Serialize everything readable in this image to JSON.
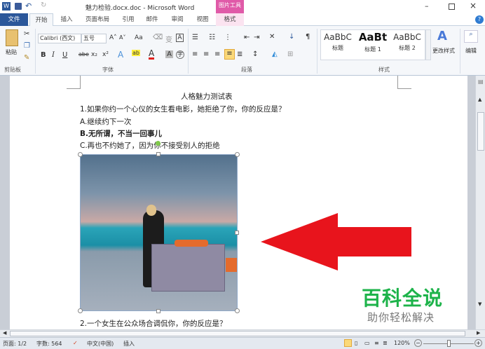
{
  "window": {
    "title": "魅力检验.docx.doc - Microsoft Word",
    "contextual_tab": "图片工具"
  },
  "quick_access": {
    "undo": "↶",
    "redo": "↻"
  },
  "tabs": [
    "文件",
    "开始",
    "插入",
    "页面布局",
    "引用",
    "邮件",
    "审阅",
    "视图",
    "格式"
  ],
  "ribbon": {
    "clipboard": {
      "paste": "粘贴",
      "group": "剪贴板"
    },
    "font": {
      "name": "Calibri (西文)",
      "size": "五号",
      "group": "字体",
      "bold": "B",
      "italic": "I",
      "underline": "U",
      "strike": "abe",
      "sub": "x₂",
      "sup": "x²",
      "grow": "A˄",
      "shrink": "A˅",
      "case": "Aa"
    },
    "paragraph": {
      "group": "段落"
    },
    "styles": {
      "items": [
        {
          "preview": "AaBbC",
          "label": "标题"
        },
        {
          "preview": "AaBt",
          "label": "标题 1"
        },
        {
          "preview": "AaBbC",
          "label": "标题 2"
        }
      ],
      "change": "更改样式",
      "group": "样式"
    },
    "editing": {
      "label": "编辑"
    }
  },
  "document": {
    "title": "人格魅力测试表",
    "lines": [
      "1.如果你约一个心仪的女生看电影，她拒绝了你，你的反应是？",
      "A.继续约下一次",
      "B.无所谓，不当一回事儿",
      "C.再也不约她了，因为你不接受别人的拒绝"
    ],
    "after_image": "2.一个女生在公众场合调侃你，你的反应是？"
  },
  "watermark": {
    "title": "百科全说",
    "subtitle": "助你轻松解决"
  },
  "colors": {
    "accent": "#2b579a",
    "arrow": "#e8141c",
    "watermark": "#1db34a"
  },
  "status": {
    "page": "页面: 1/2",
    "words": "字数: 564",
    "language": "中文(中国)",
    "mode": "插入",
    "zoom": "120%",
    "zoom_fraction": 0.5
  }
}
